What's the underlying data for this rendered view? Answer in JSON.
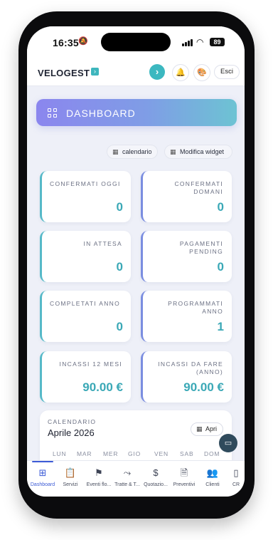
{
  "status_bar": {
    "time": "16:35",
    "battery": "89",
    "icons": [
      "bell-slash-icon",
      "signal-icon",
      "wifi-icon",
      "battery-icon"
    ]
  },
  "header": {
    "brand": "VELOGEST",
    "brand_mark": "›",
    "go_icon": "›",
    "exit_label": "Esci"
  },
  "banner": {
    "title": "DASHBOARD",
    "icon": "grid-icon"
  },
  "toolbar": {
    "calendar_label": "calendario",
    "widget_label": "Modifica widget"
  },
  "stats": [
    {
      "label": "CONFERMATI OGGI",
      "value": "0"
    },
    {
      "label": "CONFERMATI DOMANI",
      "value": "0"
    },
    {
      "label": "IN ATTESA",
      "value": "0"
    },
    {
      "label": "PAGAMENTI PENDING",
      "value": "0"
    },
    {
      "label": "COMPLETATI ANNO",
      "value": "0"
    },
    {
      "label": "PROGRAMMATI ANNO",
      "value": "1"
    },
    {
      "label": "INCASSI 12 MESI",
      "value": "90.00 €"
    },
    {
      "label": "INCASSI DA FARE (ANNO)",
      "value": "90.00 €"
    }
  ],
  "calendar": {
    "kicker": "CALENDARIO",
    "title": "Aprile 2026",
    "open_label": "Apri",
    "weekdays": [
      "LUN",
      "MAR",
      "MER",
      "GIO",
      "VEN",
      "SAB",
      "DOM"
    ]
  },
  "tabs": [
    {
      "label": "Dashboard",
      "icon": "grid-icon"
    },
    {
      "label": "Servizi",
      "icon": "clipboard-icon"
    },
    {
      "label": "Eventi flo...",
      "icon": "flag-icon"
    },
    {
      "label": "Tratte & T...",
      "icon": "route-icon"
    },
    {
      "label": "Quotazio...",
      "icon": "dollar-icon"
    },
    {
      "label": "Preventivi",
      "icon": "document-check-icon"
    },
    {
      "label": "Clienti",
      "icon": "users-icon"
    },
    {
      "label": "CR",
      "icon": "book-icon"
    }
  ],
  "colors": {
    "accent": "#3cb8c0",
    "value_teal": "#3aa8b6",
    "banner_start": "#8b86ee",
    "banner_end": "#6dc3d3",
    "tab_active": "#3c5bd6"
  }
}
